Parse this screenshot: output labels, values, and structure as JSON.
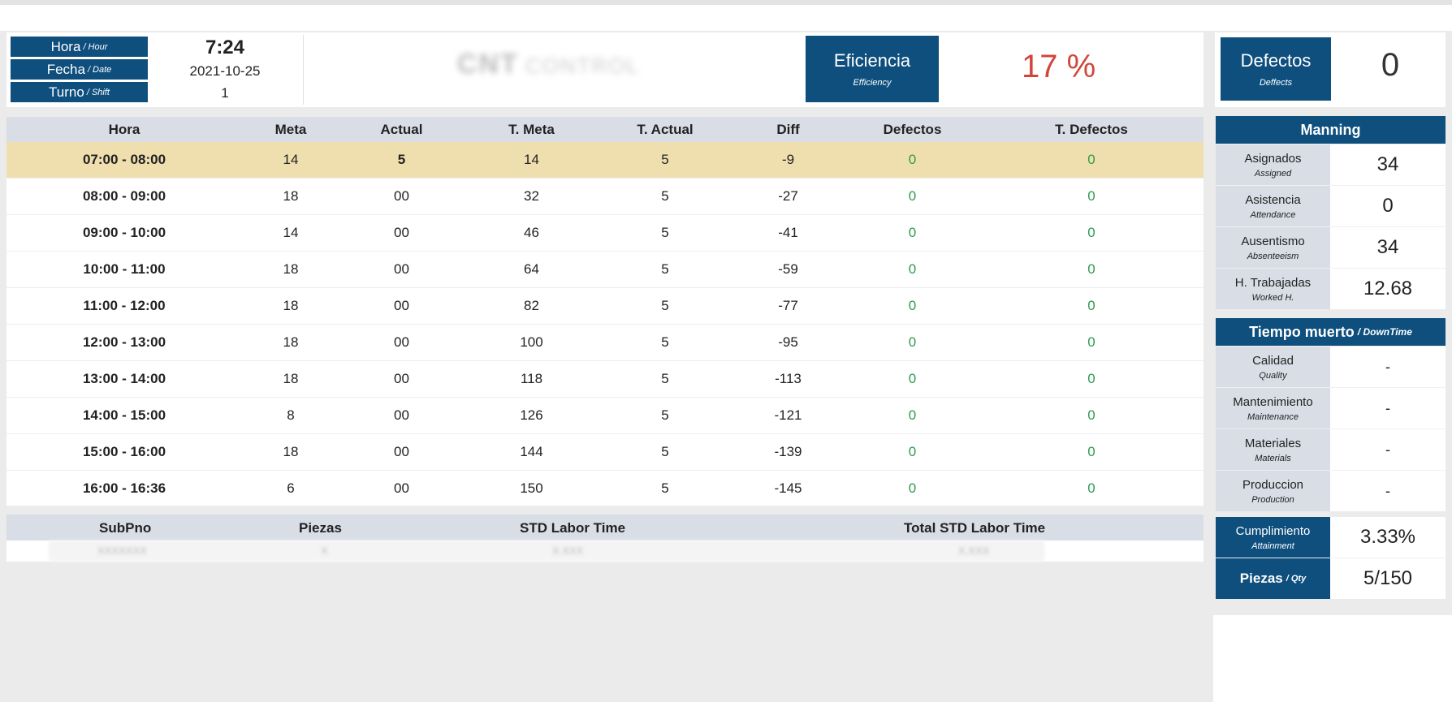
{
  "header": {
    "hour_label": "Hora",
    "hour_label_en": "/ Hour",
    "hour_value": "7:24",
    "date_label": "Fecha",
    "date_label_en": "/ Date",
    "date_value": "2021-10-25",
    "shift_label": "Turno",
    "shift_label_en": "/ Shift",
    "shift_value": "1",
    "logo_text": "CNT",
    "logo_sub": "CONTROL",
    "efficiency_label": "Eficiencia",
    "efficiency_label_en": "Efficiency",
    "efficiency_value": "17 %",
    "defects_label": "Defectos",
    "defects_label_en": "Deffects",
    "defects_value": "0"
  },
  "table": {
    "columns": [
      "Hora",
      "Meta",
      "Actual",
      "T. Meta",
      "T. Actual",
      "Diff",
      "Defectos",
      "T. Defectos"
    ],
    "rows": [
      {
        "hora": "07:00 - 08:00",
        "meta": "14",
        "actual": "5",
        "t_meta": "14",
        "t_actual": "5",
        "diff": "-9",
        "defectos": "0",
        "t_defectos": "0"
      },
      {
        "hora": "08:00 - 09:00",
        "meta": "18",
        "actual": "00",
        "t_meta": "32",
        "t_actual": "5",
        "diff": "-27",
        "defectos": "0",
        "t_defectos": "0"
      },
      {
        "hora": "09:00 - 10:00",
        "meta": "14",
        "actual": "00",
        "t_meta": "46",
        "t_actual": "5",
        "diff": "-41",
        "defectos": "0",
        "t_defectos": "0"
      },
      {
        "hora": "10:00 - 11:00",
        "meta": "18",
        "actual": "00",
        "t_meta": "64",
        "t_actual": "5",
        "diff": "-59",
        "defectos": "0",
        "t_defectos": "0"
      },
      {
        "hora": "11:00 - 12:00",
        "meta": "18",
        "actual": "00",
        "t_meta": "82",
        "t_actual": "5",
        "diff": "-77",
        "defectos": "0",
        "t_defectos": "0"
      },
      {
        "hora": "12:00 - 13:00",
        "meta": "18",
        "actual": "00",
        "t_meta": "100",
        "t_actual": "5",
        "diff": "-95",
        "defectos": "0",
        "t_defectos": "0"
      },
      {
        "hora": "13:00 - 14:00",
        "meta": "18",
        "actual": "00",
        "t_meta": "118",
        "t_actual": "5",
        "diff": "-113",
        "defectos": "0",
        "t_defectos": "0"
      },
      {
        "hora": "14:00 - 15:00",
        "meta": "8",
        "actual": "00",
        "t_meta": "126",
        "t_actual": "5",
        "diff": "-121",
        "defectos": "0",
        "t_defectos": "0"
      },
      {
        "hora": "15:00 - 16:00",
        "meta": "18",
        "actual": "00",
        "t_meta": "144",
        "t_actual": "5",
        "diff": "-139",
        "defectos": "0",
        "t_defectos": "0"
      },
      {
        "hora": "16:00 - 16:36",
        "meta": "6",
        "actual": "00",
        "t_meta": "150",
        "t_actual": "5",
        "diff": "-145",
        "defectos": "0",
        "t_defectos": "0"
      }
    ]
  },
  "subpno": {
    "columns": [
      "SubPno",
      "Piezas",
      "STD Labor Time",
      "Total STD Labor Time"
    ],
    "row": [
      "XXXXXXX",
      "X",
      "X.XXX",
      "X.XXX"
    ]
  },
  "manning": {
    "title": "Manning",
    "items": [
      {
        "label": "Asignados",
        "label_en": "Assigned",
        "value": "34"
      },
      {
        "label": "Asistencia",
        "label_en": "Attendance",
        "value": "0"
      },
      {
        "label": "Ausentismo",
        "label_en": "Absenteeism",
        "value": "34"
      },
      {
        "label": "H. Trabajadas",
        "label_en": "Worked H.",
        "value": "12.68"
      }
    ]
  },
  "downtime": {
    "title": "Tiempo muerto",
    "title_en": "/ DownTime",
    "items": [
      {
        "label": "Calidad",
        "label_en": "Quality",
        "value": "-"
      },
      {
        "label": "Mantenimiento",
        "label_en": "Maintenance",
        "value": "-"
      },
      {
        "label": "Materiales",
        "label_en": "Materials",
        "value": "-"
      },
      {
        "label": "Produccion",
        "label_en": "Production",
        "value": "-"
      }
    ]
  },
  "summary": {
    "attainment_label": "Cumplimiento",
    "attainment_label_en": "Attainment",
    "attainment_value": "3.33%",
    "qty_label": "Piezas",
    "qty_label_en": "/ Qty",
    "qty_value": "5/150"
  },
  "colors": {
    "navy": "#0e4f7e",
    "highlight_row": "#efdfae",
    "efficiency_red": "#d1463b",
    "defect_green": "#2e9a4d"
  }
}
